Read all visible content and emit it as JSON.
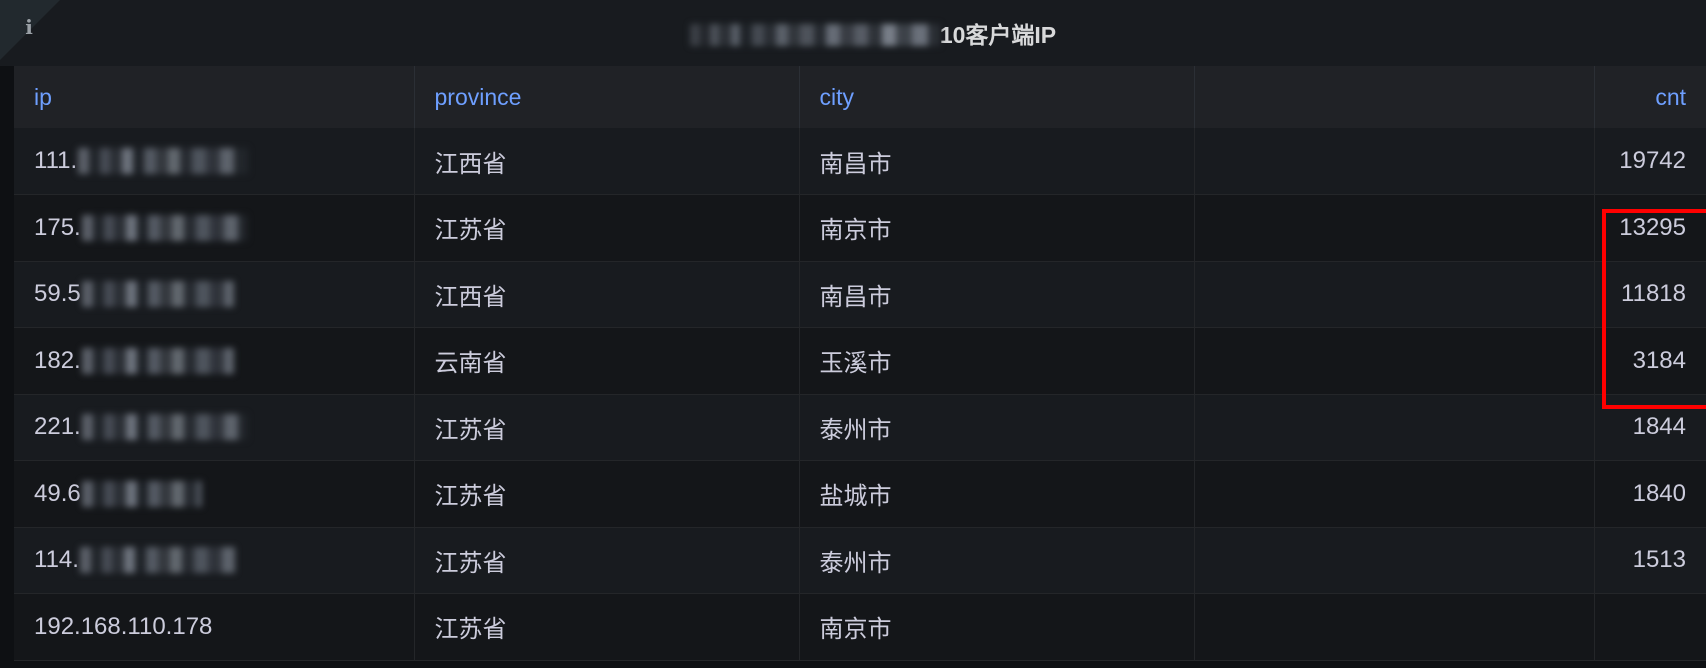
{
  "panel": {
    "info_icon": "info-icon",
    "info_glyph": "i",
    "title_redacted_prefix": "",
    "title_suffix": "10客户端IP"
  },
  "table": {
    "columns": [
      {
        "key": "ip",
        "label": "ip",
        "align": "left"
      },
      {
        "key": "province",
        "label": "province",
        "align": "left"
      },
      {
        "key": "city",
        "label": "city",
        "align": "left"
      },
      {
        "key": "spacer",
        "label": "",
        "align": "left"
      },
      {
        "key": "cnt",
        "label": "cnt",
        "align": "right"
      }
    ],
    "rows": [
      {
        "ip_prefix": "111.",
        "ip_redacted": true,
        "ip_blur_width": 170,
        "province": "江西省",
        "city": "南昌市",
        "cnt": "19742"
      },
      {
        "ip_prefix": "175.",
        "ip_redacted": true,
        "ip_blur_width": 165,
        "province": "江苏省",
        "city": "南京市",
        "cnt": "13295"
      },
      {
        "ip_prefix": "59.5",
        "ip_redacted": true,
        "ip_blur_width": 152,
        "province": "江西省",
        "city": "南昌市",
        "cnt": "11818"
      },
      {
        "ip_prefix": "182.",
        "ip_redacted": true,
        "ip_blur_width": 152,
        "province": "云南省",
        "city": "玉溪市",
        "cnt": "3184"
      },
      {
        "ip_prefix": "221.",
        "ip_redacted": true,
        "ip_blur_width": 165,
        "province": "江苏省",
        "city": "泰州市",
        "cnt": "1844"
      },
      {
        "ip_prefix": "49.6",
        "ip_redacted": true,
        "ip_blur_width": 120,
        "province": "江苏省",
        "city": "盐城市",
        "cnt": "1840"
      },
      {
        "ip_prefix": "114.",
        "ip_redacted": true,
        "ip_blur_width": 155,
        "province": "江苏省",
        "city": "泰州市",
        "cnt": "1513"
      },
      {
        "ip_prefix": "192.168.110.178",
        "ip_redacted": false,
        "ip_blur_width": 0,
        "province": "江苏省",
        "city": "南京市",
        "cnt": ""
      }
    ]
  },
  "annotation": {
    "name": "red-highlight-box",
    "color": "#ff0000",
    "covers_cells": [
      "19742",
      "13295",
      "11818"
    ]
  },
  "colors": {
    "panel_background": "#141619",
    "header_background": "#181b1f",
    "table_header_background": "#202226",
    "row_odd_background": "#181b1f",
    "row_even_background": "#141619",
    "column_header_text": "#6e9fff",
    "cell_text": "#ccccdc",
    "title_text": "#d8d9da",
    "highlight": "#ff0000"
  }
}
